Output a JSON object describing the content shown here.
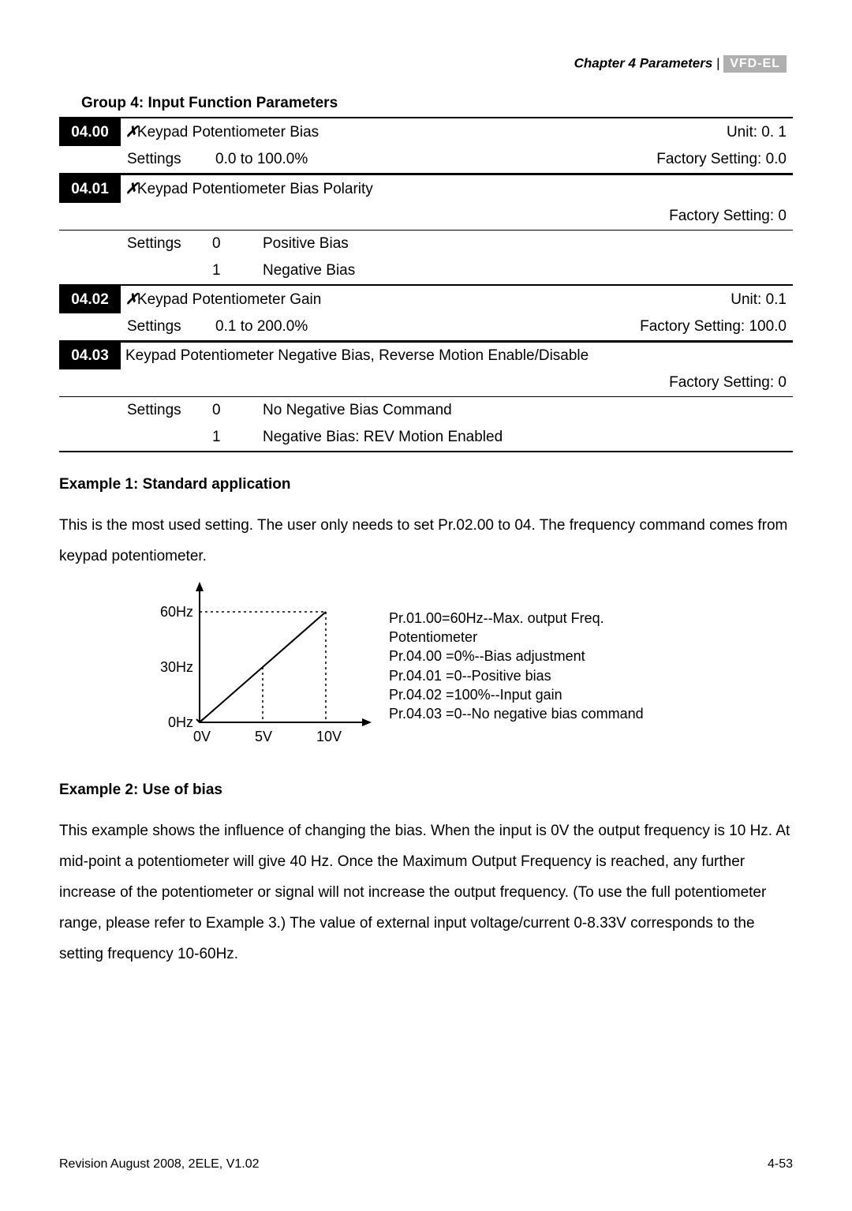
{
  "header": {
    "chapter": "Chapter 4 Parameters",
    "sep": " | ",
    "logo": "VFD-EL"
  },
  "group_title": "Group 4:  Input Function Parameters",
  "params": [
    {
      "code": "04.00",
      "glyph": "✗",
      "name": "Keypad Potentiometer Bias",
      "unit": "Unit: 0. 1",
      "settings_label": "Settings",
      "range": "0.0 to 100.0%",
      "factory": "Factory Setting: 0.0",
      "options": []
    },
    {
      "code": "04.01",
      "glyph": "✗",
      "name": "Keypad Potentiometer Bias Polarity",
      "unit": "",
      "settings_label": "Settings",
      "range": "",
      "factory": "Factory Setting: 0",
      "options": [
        {
          "num": "0",
          "text": "Positive Bias"
        },
        {
          "num": "1",
          "text": "Negative Bias"
        }
      ]
    },
    {
      "code": "04.02",
      "glyph": "✗",
      "name": "Keypad Potentiometer Gain",
      "unit": "Unit: 0.1",
      "settings_label": "Settings",
      "range": "0.1 to 200.0%",
      "factory": "Factory Setting: 100.0",
      "options": []
    },
    {
      "code": "04.03",
      "glyph": "",
      "name": "Keypad Potentiometer Negative Bias, Reverse Motion Enable/Disable",
      "unit": "",
      "settings_label": "Settings",
      "range": "",
      "factory": "Factory Setting: 0",
      "options": [
        {
          "num": "0",
          "text": "No Negative Bias Command"
        },
        {
          "num": "1",
          "text": "Negative Bias: REV Motion Enabled"
        }
      ]
    }
  ],
  "example1": {
    "heading": "Example 1: Standard application",
    "text": "This is the most used setting. The user only needs to set Pr.02.00 to 04. The frequency command comes from keypad potentiometer."
  },
  "chart_data": {
    "type": "line",
    "x": [
      0,
      5,
      10
    ],
    "y": [
      0,
      30,
      60
    ],
    "xlabel_unit": "V",
    "ylabel_unit": "Hz",
    "x_ticks": [
      "0V",
      "5V",
      "10V"
    ],
    "y_ticks": [
      "0Hz",
      "30Hz",
      "60Hz"
    ],
    "ylim": [
      0,
      60
    ],
    "xlim": [
      0,
      10
    ],
    "side_lines": [
      "Pr.01.00=60Hz--Max. output Freq.",
      "Potentiometer",
      "Pr.04.00  =0%--Bias adjustment",
      "Pr.04.01  =0--Positive bias",
      "Pr.04.02  =100%--Input gain",
      "Pr.04.03  =0--No negative bias command"
    ]
  },
  "example2": {
    "heading": "Example 2: Use of bias",
    "text": "This example shows the influence of changing the bias. When the input is 0V the output frequency is 10 Hz. At mid-point a potentiometer will give 40 Hz. Once the Maximum Output Frequency is reached, any further increase of the potentiometer or signal will not increase the output frequency. (To use the full potentiometer range, please refer to Example 3.) The value of external input voltage/current 0-8.33V corresponds to the setting frequency 10-60Hz."
  },
  "footer": {
    "left": "Revision August 2008, 2ELE, V1.02",
    "right": "4-53"
  }
}
